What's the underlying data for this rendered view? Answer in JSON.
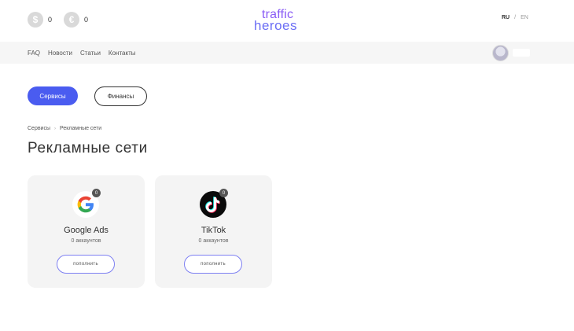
{
  "header": {
    "balances": [
      {
        "currency_icon": "dollar-coin-icon",
        "symbol": "$",
        "amount": "0"
      },
      {
        "currency_icon": "euro-coin-icon",
        "symbol": "€",
        "amount": "0"
      }
    ],
    "logo": {
      "line1": "traffic",
      "line2": "heroes"
    },
    "lang": {
      "ru": "RU",
      "sep": "/",
      "en": "EN"
    }
  },
  "nav": {
    "items": [
      "FAQ",
      "Новости",
      "Статьи",
      "Контакты"
    ]
  },
  "tabs": {
    "services": "Сервисы",
    "finance": "Финансы"
  },
  "breadcrumb": {
    "root": "Сервисы",
    "sep": "›",
    "current": "Рекламные сети"
  },
  "page_title": "Рекламные сети",
  "cards": [
    {
      "icon": "google-icon",
      "badge": "0",
      "name": "Google Ads",
      "accounts": "0 аккаунтов",
      "button": "пополнить"
    },
    {
      "icon": "tiktok-icon",
      "badge": "0",
      "name": "TikTok",
      "accounts": "0 аккаунтов",
      "button": "пополнить"
    }
  ],
  "colors": {
    "accent": "#4a5cf0",
    "card_bg": "#f4f4f4",
    "nav_bg": "#f6f6f6"
  }
}
